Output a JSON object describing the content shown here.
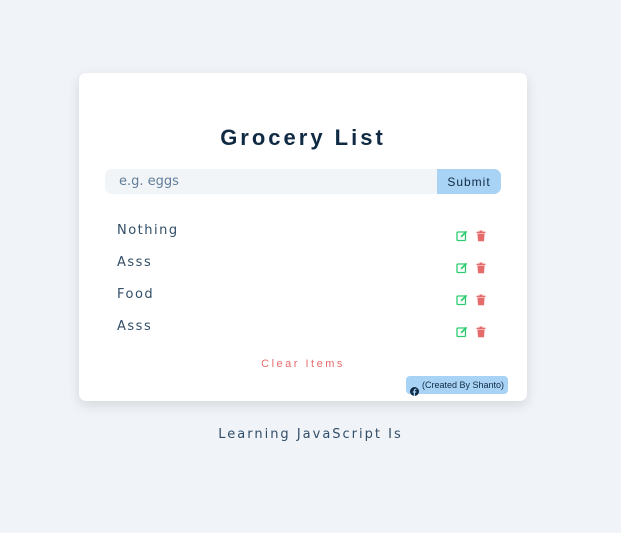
{
  "title": "Grocery List",
  "form": {
    "placeholder": "e.g. eggs",
    "value": "",
    "submit_label": "Submit"
  },
  "items": [
    {
      "label": "Nothing",
      "edit_icon": "edit-icon",
      "delete_icon": "trash-icon"
    },
    {
      "label": "Asss",
      "edit_icon": "edit-icon",
      "delete_icon": "trash-icon"
    },
    {
      "label": "Food",
      "edit_icon": "edit-icon",
      "delete_icon": "trash-icon"
    },
    {
      "label": "Asss",
      "edit_icon": "edit-icon",
      "delete_icon": "trash-icon"
    }
  ],
  "clear_label": "Clear Items",
  "credit": {
    "icon": "facebook-icon",
    "label": "(Created By Shanto)"
  },
  "footer_text": "Learning JavaScript Is",
  "colors": {
    "background": "#f0f4f8",
    "title": "#102a43",
    "accent": "#a8d3f5",
    "edit": "#2ecc71",
    "delete": "#e66b6b"
  }
}
